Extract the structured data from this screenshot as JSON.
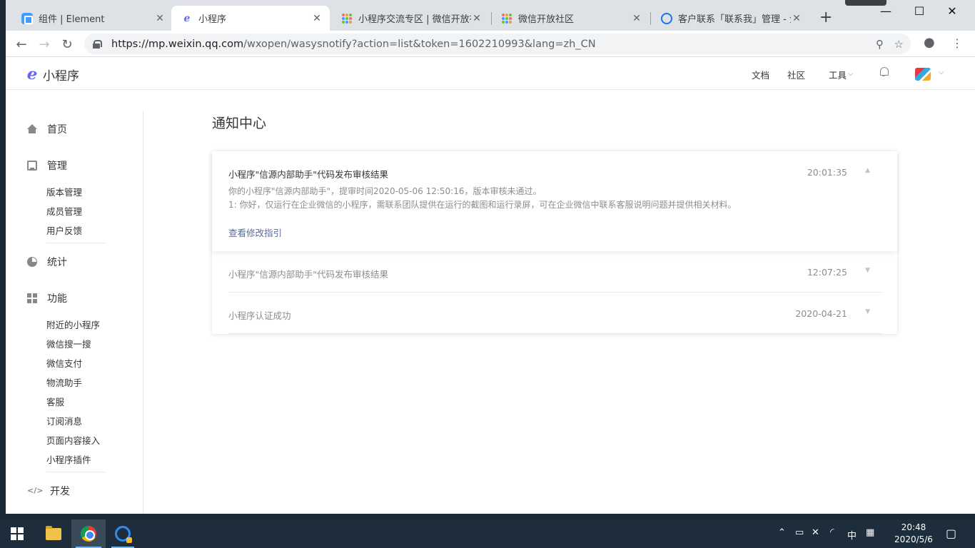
{
  "browser": {
    "tabs": [
      {
        "title": "组件 | Element",
        "favicon": "element-icon",
        "active": false
      },
      {
        "title": "小程序",
        "favicon": "miniprogram-icon",
        "active": true
      },
      {
        "title": "小程序交流专区 | 微信开放社区",
        "favicon": "wechat-community-icon",
        "active": false
      },
      {
        "title": "微信开放社区",
        "favicon": "wechat-community-icon",
        "active": false
      },
      {
        "title": "客户联系「联系我」管理 - 企",
        "favicon": "wework-icon",
        "active": false
      }
    ],
    "url_host": "https://mp.weixin.qq.com",
    "url_path": "/wxopen/wasysnotify?action=list&token=1602210993&lang=zh_CN"
  },
  "app": {
    "brand": "小程序",
    "header_links": [
      "文档",
      "社区",
      "工具"
    ]
  },
  "sidebar": {
    "home": "首页",
    "manage": "管理",
    "manage_items": [
      "版本管理",
      "成员管理",
      "用户反馈"
    ],
    "stats": "统计",
    "features": "功能",
    "feature_items": [
      "附近的小程序",
      "微信搜一搜",
      "微信支付",
      "物流助手",
      "客服",
      "订阅消息",
      "页面内容接入",
      "小程序插件"
    ],
    "dev": "开发"
  },
  "main": {
    "title": "通知中心",
    "notices": [
      {
        "title": "小程序\"信源内部助手\"代码发布审核结果",
        "time": "20:01:35",
        "expanded": true,
        "lines": [
          "你的小程序\"信源内部助手\"，提审时间2020-05-06 12:50:16，版本审核未通过。",
          "1: 你好，仅运行在企业微信的小程序，需联系团队提供在运行的截图和运行录屏，可在企业微信中联系客服说明问题并提供相关材料。"
        ],
        "link": "查看修改指引"
      },
      {
        "title": "小程序\"信源内部助手\"代码发布审核结果",
        "time": "12:07:25",
        "expanded": false
      },
      {
        "title": "小程序认证成功",
        "time": "2020-04-21",
        "expanded": false
      }
    ]
  },
  "taskbar": {
    "ime": "中",
    "time": "20:48",
    "date": "2020/5/6"
  }
}
